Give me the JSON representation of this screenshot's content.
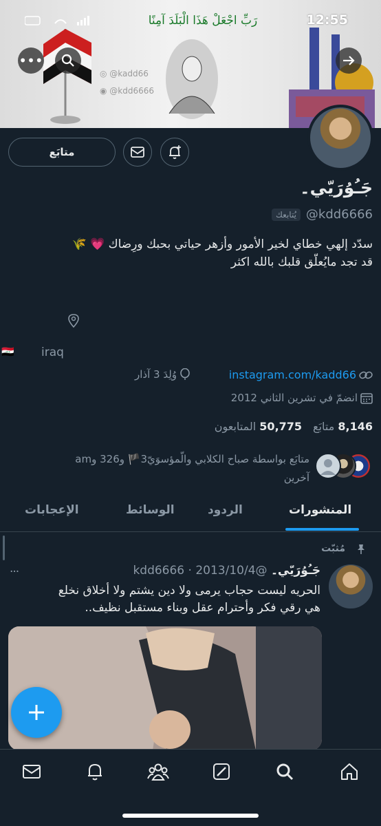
{
  "status_bar": {
    "time": "12:55"
  },
  "banner": {
    "verse": "رَبِّ اجْعَلْ هَذَا الْبَلَدَ آمِنًا",
    "instagram_handle": "@kadd66",
    "discord_handle": "@kdd6666"
  },
  "profile": {
    "display_name": "جَـُوُرَيّي۔",
    "handle": "@kdd6666",
    "follows_you_badge": "يُتابعك",
    "bio_line1": "سدّد إلهي خطاي لخير الأمور وأزهر حياتي بحبك ورِضاك 💗 🌾",
    "bio_line2": "قد تجد مايُعلّق قلبك بالله اكثر",
    "location": "iraq",
    "location_flag": "🇮🇶",
    "website": "instagram.com/kadd66",
    "birthday": "وُلِدَ 3 آذار",
    "joined": "انضمّ في تشرين الثاني 2012",
    "following_count": "8,146",
    "following_label": "متابَع",
    "followers_count": "50,775",
    "followers_label": "المتابعون",
    "followed_by_line1": "متابَع بواسطة صباح الكلابي والّمؤسوَيّ3🏴 و326 و",
    "followed_by_am": "am",
    "followed_by_line2": "آخرين"
  },
  "actions": {
    "follow_label": "متابَع"
  },
  "tabs": [
    {
      "label": "المنشورات",
      "active": true
    },
    {
      "label": "الردود",
      "active": false
    },
    {
      "label": "الوسائط",
      "active": false
    },
    {
      "label": "الإعجابات",
      "active": false
    }
  ],
  "pinned_post": {
    "pinned_label": "مُثبّت",
    "author_name": "جَـُوُرَيّي۔",
    "handle": "@kdd6666",
    "separator": "·",
    "date": "2013/10/4",
    "more": "...",
    "text_line1": "الحريه ليست حجاب يرمى ولا دين يشتم ولا أخلاق نخلع",
    "text_line2": "هي رقي فكر وأحترام عقل وبناء مستقبل نظيف.."
  },
  "colors": {
    "accent": "#1d9bf0",
    "background": "#15202b",
    "muted": "#8b98a5",
    "border": "#536471"
  }
}
